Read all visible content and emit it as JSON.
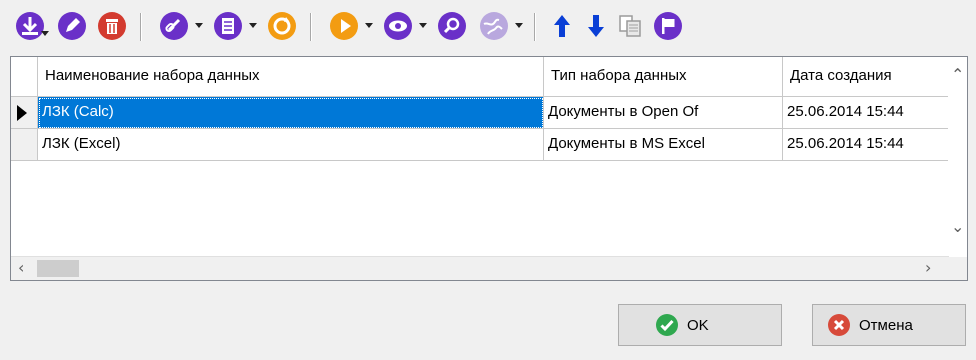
{
  "colors": {
    "accent": "#0078d7",
    "toolbar_purple": "#6a30c8",
    "toolbar_red": "#d33b2f",
    "toolbar_orange": "#f39c12",
    "arrow_blue": "#0a3fd6",
    "ok_green": "#2fa84f",
    "cancel_red": "#d74a3a"
  },
  "toolbar": {
    "icons": [
      "download-icon",
      "edit-icon",
      "delete-icon",
      "link-icon",
      "list-icon",
      "refresh-icon",
      "play-icon",
      "view-icon",
      "search-icon",
      "globe-icon",
      "move-up-icon",
      "move-down-icon",
      "copy-icon",
      "flag-icon"
    ]
  },
  "grid": {
    "columns": [
      "Наименование набора данных",
      "Тип набора данных",
      "Дата создания"
    ],
    "rows": [
      [
        "ЛЗК (Calc)",
        "Документы в Open Of",
        "25.06.2014 15:44"
      ],
      [
        "ЛЗК (Excel)",
        "Документы в MS Excel",
        "25.06.2014 15:44"
      ]
    ],
    "selected_row": 0
  },
  "buttons": {
    "ok": "OK",
    "cancel": "Отмена"
  }
}
